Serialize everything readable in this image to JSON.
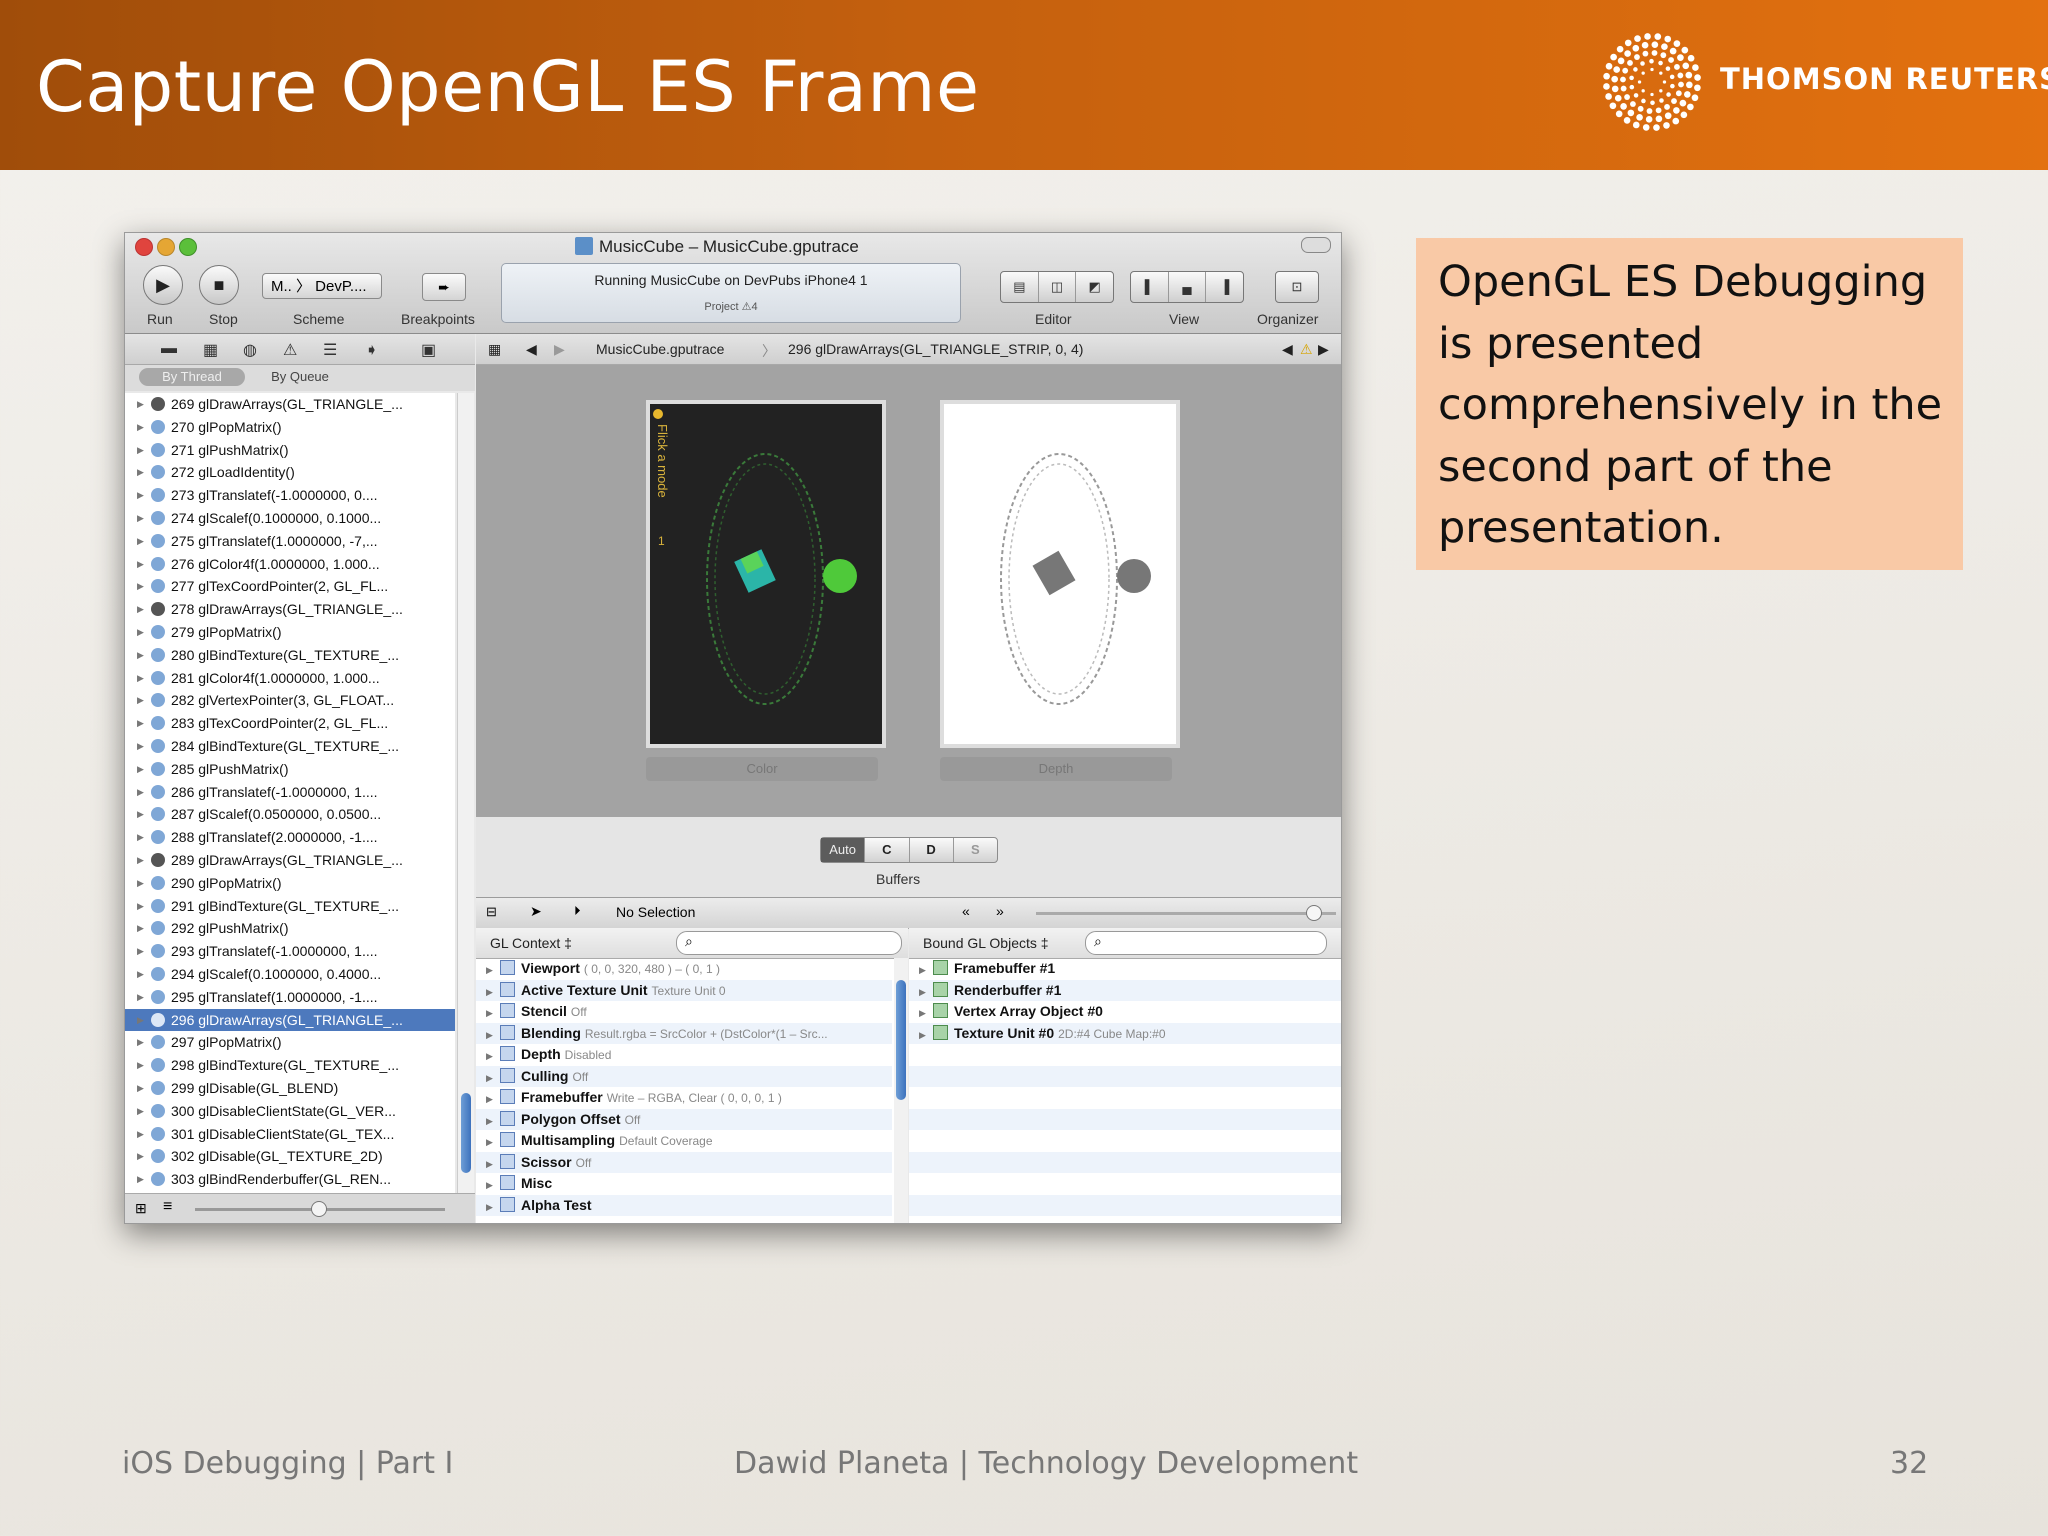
{
  "slide": {
    "title": "Capture OpenGL ES Frame",
    "logo_text": "THOMSON REUTERS",
    "callout": "OpenGL ES Debugging is presented comprehensively in the second part of the presentation.",
    "footer_left": "iOS Debugging | Part I",
    "footer_center": "Dawid Planeta | Technology Development",
    "page_number": "32"
  },
  "colors": {
    "banner_start": "#a04d0a",
    "banner_end": "#e3710f",
    "callout_bg": "#f9c9a6",
    "selection": "#4d79bd"
  },
  "window": {
    "title": "MusicCube – MusicCube.gputrace",
    "toolbar": {
      "run_label": "Run",
      "stop_label": "Stop",
      "scheme_label": "Scheme",
      "scheme_value": "M..  〉 DevP....",
      "breakpoints_label": "Breakpoints",
      "editor_label": "Editor",
      "view_label": "View",
      "organizer_label": "Organizer",
      "activity_text": "Running MusicCube on DevPubs iPhone4 1",
      "activity_sub": "Project  ⚠4"
    },
    "navigator": {
      "filter_by_thread": "By Thread",
      "filter_by_queue": "By Queue",
      "calls": [
        {
          "label": "269 glDrawArrays(GL_TRIANGLE_...",
          "icon": "draw"
        },
        {
          "label": "270 glPopMatrix()",
          "icon": "call"
        },
        {
          "label": "271 glPushMatrix()",
          "icon": "call"
        },
        {
          "label": "272 glLoadIdentity()",
          "icon": "call"
        },
        {
          "label": "273 glTranslatef(-1.0000000, 0....",
          "icon": "call"
        },
        {
          "label": "274 glScalef(0.1000000, 0.1000...",
          "icon": "call"
        },
        {
          "label": "275 glTranslatef(1.0000000, -7,...",
          "icon": "call"
        },
        {
          "label": "276 glColor4f(1.0000000, 1.000...",
          "icon": "call"
        },
        {
          "label": "277 glTexCoordPointer(2, GL_FL...",
          "icon": "call"
        },
        {
          "label": "278 glDrawArrays(GL_TRIANGLE_...",
          "icon": "draw"
        },
        {
          "label": "279 glPopMatrix()",
          "icon": "call"
        },
        {
          "label": "280 glBindTexture(GL_TEXTURE_...",
          "icon": "call"
        },
        {
          "label": "281 glColor4f(1.0000000, 1.000...",
          "icon": "call"
        },
        {
          "label": "282 glVertexPointer(3, GL_FLOAT...",
          "icon": "call"
        },
        {
          "label": "283 glTexCoordPointer(2, GL_FL...",
          "icon": "call"
        },
        {
          "label": "284 glBindTexture(GL_TEXTURE_...",
          "icon": "call"
        },
        {
          "label": "285 glPushMatrix()",
          "icon": "call"
        },
        {
          "label": "286 glTranslatef(-1.0000000, 1....",
          "icon": "call"
        },
        {
          "label": "287 glScalef(0.0500000, 0.0500...",
          "icon": "call"
        },
        {
          "label": "288 glTranslatef(2.0000000, -1....",
          "icon": "call"
        },
        {
          "label": "289 glDrawArrays(GL_TRIANGLE_...",
          "icon": "draw"
        },
        {
          "label": "290 glPopMatrix()",
          "icon": "call"
        },
        {
          "label": "291 glBindTexture(GL_TEXTURE_...",
          "icon": "call"
        },
        {
          "label": "292 glPushMatrix()",
          "icon": "call"
        },
        {
          "label": "293 glTranslatef(-1.0000000, 1....",
          "icon": "call"
        },
        {
          "label": "294 glScalef(0.1000000, 0.4000...",
          "icon": "call"
        },
        {
          "label": "295 glTranslatef(1.0000000, -1....",
          "icon": "call"
        },
        {
          "label": "296 glDrawArrays(GL_TRIANGLE_...",
          "icon": "draw",
          "selected": true
        },
        {
          "label": "297 glPopMatrix()",
          "icon": "call"
        },
        {
          "label": "298 glBindTexture(GL_TEXTURE_...",
          "icon": "call"
        },
        {
          "label": "299 glDisable(GL_BLEND)",
          "icon": "call"
        },
        {
          "label": "300 glDisableClientState(GL_VER...",
          "icon": "call"
        },
        {
          "label": "301 glDisableClientState(GL_TEX...",
          "icon": "call"
        },
        {
          "label": "302 glDisable(GL_TEXTURE_2D)",
          "icon": "call"
        },
        {
          "label": "303 glBindRenderbuffer(GL_REN...",
          "icon": "call"
        }
      ]
    },
    "jumpbar": {
      "file": "MusicCube.gputrace",
      "call": "296 glDrawArrays(GL_TRIANGLE_STRIP, 0, 4)"
    },
    "canvas": {
      "color_label": "Color",
      "depth_label": "Depth",
      "overlay_text": "Flick a mode",
      "overlay_num": "1",
      "buffers": [
        "Auto",
        "C",
        "D",
        "S"
      ],
      "buffers_label": "Buffers"
    },
    "debug": {
      "selection": "No Selection",
      "left_header": "GL Context ‡",
      "right_header": "Bound GL Objects ‡",
      "context_rows": [
        {
          "name": "Viewport",
          "value": "( 0, 0, 320, 480 ) – ( 0, 1 )"
        },
        {
          "name": "Active Texture Unit",
          "value": "Texture Unit 0"
        },
        {
          "name": "Stencil",
          "value": "Off"
        },
        {
          "name": "Blending",
          "value": "Result.rgba = SrcColor + (DstColor*(1 – Src..."
        },
        {
          "name": "Depth",
          "value": "Disabled"
        },
        {
          "name": "Culling",
          "value": "Off"
        },
        {
          "name": "Framebuffer",
          "value": "Write – RGBA, Clear ( 0, 0, 0, 1 )"
        },
        {
          "name": "Polygon Offset",
          "value": "Off"
        },
        {
          "name": "Multisampling",
          "value": "Default Coverage"
        },
        {
          "name": "Scissor",
          "value": "Off"
        },
        {
          "name": "Misc",
          "value": ""
        },
        {
          "name": "Alpha Test",
          "value": ""
        }
      ],
      "object_rows": [
        {
          "name": "Framebuffer #1",
          "value": ""
        },
        {
          "name": "Renderbuffer #1",
          "value": ""
        },
        {
          "name": "Vertex Array Object #0",
          "value": ""
        },
        {
          "name": "Texture Unit #0",
          "value": "2D:#4  Cube Map:#0"
        }
      ]
    }
  }
}
